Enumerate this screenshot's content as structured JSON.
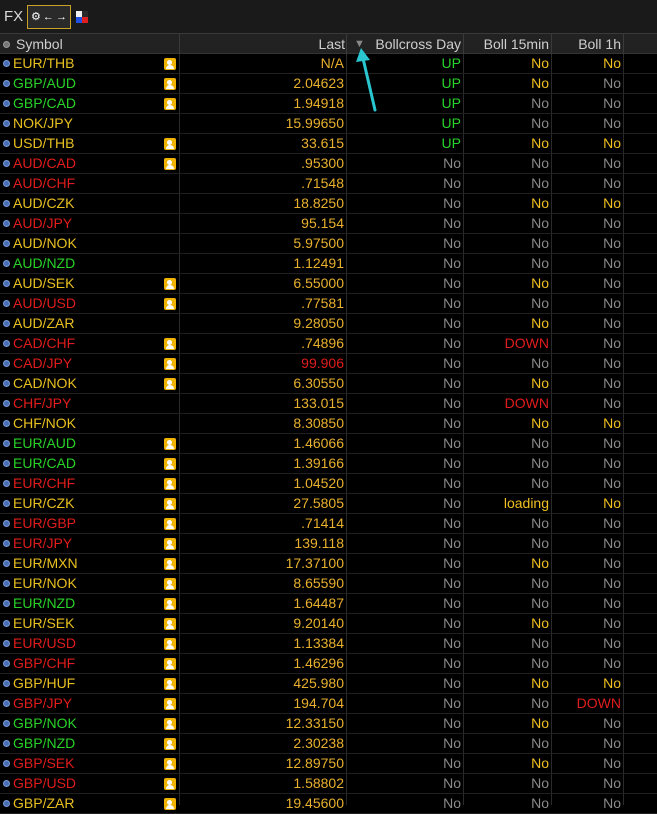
{
  "window": {
    "title": "FX"
  },
  "toolbar": {
    "settings_icon": "gear-icon",
    "link_icon": "link-color-icon"
  },
  "headers": {
    "symbol": "Symbol",
    "last": "Last",
    "bollcross_day": "Bollcross Day",
    "boll_15min": "Boll 15min",
    "boll_1h": "Boll 1h"
  },
  "sort": {
    "column": "bollcross_day",
    "direction": "descending"
  },
  "colors": {
    "up": "#29d229",
    "down": "#e01c1c",
    "neutral": "#e8c020",
    "no_dim": "#8a8a8a",
    "no_yellow": "#f0c020",
    "down_red": "#e01c1c",
    "loading": "#f0c020",
    "last": "#e8b02e",
    "arrow": "#29c6d0"
  },
  "rows": [
    {
      "symbol": "EUR/THB",
      "sym_color": "neutral",
      "alert": true,
      "last": "N/A",
      "bcd": "UP",
      "b15": "No",
      "b15c": "yellow",
      "b1h": "No",
      "b1hc": "yellow"
    },
    {
      "symbol": "GBP/AUD",
      "sym_color": "up",
      "alert": true,
      "last": "2.04623",
      "bcd": "UP",
      "b15": "No",
      "b15c": "yellow",
      "b1h": "No",
      "b1hc": "dim"
    },
    {
      "symbol": "GBP/CAD",
      "sym_color": "up",
      "alert": true,
      "last": "1.94918",
      "bcd": "UP",
      "b15": "No",
      "b15c": "dim",
      "b1h": "No",
      "b1hc": "dim"
    },
    {
      "symbol": "NOK/JPY",
      "sym_color": "neutral",
      "alert": false,
      "last": "15.99650",
      "bcd": "UP",
      "b15": "No",
      "b15c": "dim",
      "b1h": "No",
      "b1hc": "dim"
    },
    {
      "symbol": "USD/THB",
      "sym_color": "neutral",
      "alert": true,
      "last": "33.615",
      "bcd": "UP",
      "b15": "No",
      "b15c": "yellow",
      "b1h": "No",
      "b1hc": "yellow"
    },
    {
      "symbol": "AUD/CAD",
      "sym_color": "down",
      "alert": true,
      "last": ".95300",
      "bcd": "No",
      "b15": "No",
      "b15c": "dim",
      "b1h": "No",
      "b1hc": "dim"
    },
    {
      "symbol": "AUD/CHF",
      "sym_color": "down",
      "alert": false,
      "last": ".71548",
      "bcd": "No",
      "b15": "No",
      "b15c": "dim",
      "b1h": "No",
      "b1hc": "dim"
    },
    {
      "symbol": "AUD/CZK",
      "sym_color": "neutral",
      "alert": false,
      "last": "18.8250",
      "bcd": "No",
      "b15": "No",
      "b15c": "yellow",
      "b1h": "No",
      "b1hc": "yellow"
    },
    {
      "symbol": "AUD/JPY",
      "sym_color": "down",
      "alert": false,
      "last": "95.154",
      "bcd": "No",
      "b15": "No",
      "b15c": "dim",
      "b1h": "No",
      "b1hc": "dim"
    },
    {
      "symbol": "AUD/NOK",
      "sym_color": "neutral",
      "alert": false,
      "last": "5.97500",
      "bcd": "No",
      "b15": "No",
      "b15c": "dim",
      "b1h": "No",
      "b1hc": "dim"
    },
    {
      "symbol": "AUD/NZD",
      "sym_color": "up",
      "alert": false,
      "last": "1.12491",
      "bcd": "No",
      "b15": "No",
      "b15c": "dim",
      "b1h": "No",
      "b1hc": "dim"
    },
    {
      "symbol": "AUD/SEK",
      "sym_color": "neutral",
      "alert": true,
      "last": "6.55000",
      "bcd": "No",
      "b15": "No",
      "b15c": "yellow",
      "b1h": "No",
      "b1hc": "dim"
    },
    {
      "symbol": "AUD/USD",
      "sym_color": "down",
      "alert": true,
      "last": ".77581",
      "bcd": "No",
      "b15": "No",
      "b15c": "dim",
      "b1h": "No",
      "b1hc": "dim"
    },
    {
      "symbol": "AUD/ZAR",
      "sym_color": "neutral",
      "alert": false,
      "last": "9.28050",
      "bcd": "No",
      "b15": "No",
      "b15c": "yellow",
      "b1h": "No",
      "b1hc": "dim"
    },
    {
      "symbol": "CAD/CHF",
      "sym_color": "down",
      "alert": true,
      "last": ".74896",
      "bcd": "No",
      "b15": "DOWN",
      "b15c": "red",
      "b1h": "No",
      "b1hc": "dim"
    },
    {
      "symbol": "CAD/JPY",
      "sym_color": "down",
      "alert": true,
      "last": "99.906",
      "last_red": true,
      "bcd": "No",
      "b15": "No",
      "b15c": "dim",
      "b1h": "No",
      "b1hc": "dim"
    },
    {
      "symbol": "CAD/NOK",
      "sym_color": "neutral",
      "alert": true,
      "last": "6.30550",
      "bcd": "No",
      "b15": "No",
      "b15c": "yellow",
      "b1h": "No",
      "b1hc": "dim"
    },
    {
      "symbol": "CHF/JPY",
      "sym_color": "down",
      "alert": false,
      "last": "133.015",
      "bcd": "No",
      "b15": "DOWN",
      "b15c": "red",
      "b1h": "No",
      "b1hc": "dim"
    },
    {
      "symbol": "CHF/NOK",
      "sym_color": "neutral",
      "alert": false,
      "last": "8.30850",
      "bcd": "No",
      "b15": "No",
      "b15c": "yellow",
      "b1h": "No",
      "b1hc": "yellow"
    },
    {
      "symbol": "EUR/AUD",
      "sym_color": "up",
      "alert": true,
      "last": "1.46066",
      "bcd": "No",
      "b15": "No",
      "b15c": "dim",
      "b1h": "No",
      "b1hc": "dim"
    },
    {
      "symbol": "EUR/CAD",
      "sym_color": "up",
      "alert": true,
      "last": "1.39166",
      "bcd": "No",
      "b15": "No",
      "b15c": "dim",
      "b1h": "No",
      "b1hc": "dim"
    },
    {
      "symbol": "EUR/CHF",
      "sym_color": "down",
      "alert": true,
      "last": "1.04520",
      "bcd": "No",
      "b15": "No",
      "b15c": "dim",
      "b1h": "No",
      "b1hc": "dim"
    },
    {
      "symbol": "EUR/CZK",
      "sym_color": "neutral",
      "alert": true,
      "last": "27.5805",
      "bcd": "No",
      "b15": "loading",
      "b15c": "loading",
      "b1h": "No",
      "b1hc": "yellow"
    },
    {
      "symbol": "EUR/GBP",
      "sym_color": "down",
      "alert": true,
      "last": ".71414",
      "bcd": "No",
      "b15": "No",
      "b15c": "dim",
      "b1h": "No",
      "b1hc": "dim"
    },
    {
      "symbol": "EUR/JPY",
      "sym_color": "down",
      "alert": true,
      "last": "139.118",
      "bcd": "No",
      "b15": "No",
      "b15c": "dim",
      "b1h": "No",
      "b1hc": "dim"
    },
    {
      "symbol": "EUR/MXN",
      "sym_color": "neutral",
      "alert": true,
      "last": "17.37100",
      "bcd": "No",
      "b15": "No",
      "b15c": "yellow",
      "b1h": "No",
      "b1hc": "dim"
    },
    {
      "symbol": "EUR/NOK",
      "sym_color": "neutral",
      "alert": true,
      "last": "8.65590",
      "bcd": "No",
      "b15": "No",
      "b15c": "dim",
      "b1h": "No",
      "b1hc": "dim"
    },
    {
      "symbol": "EUR/NZD",
      "sym_color": "up",
      "alert": true,
      "last": "1.64487",
      "bcd": "No",
      "b15": "No",
      "b15c": "dim",
      "b1h": "No",
      "b1hc": "dim"
    },
    {
      "symbol": "EUR/SEK",
      "sym_color": "neutral",
      "alert": true,
      "last": "9.20140",
      "bcd": "No",
      "b15": "No",
      "b15c": "yellow",
      "b1h": "No",
      "b1hc": "dim"
    },
    {
      "symbol": "EUR/USD",
      "sym_color": "down",
      "alert": true,
      "last": "1.13384",
      "bcd": "No",
      "b15": "No",
      "b15c": "dim",
      "b1h": "No",
      "b1hc": "dim"
    },
    {
      "symbol": "GBP/CHF",
      "sym_color": "down",
      "alert": true,
      "last": "1.46296",
      "bcd": "No",
      "b15": "No",
      "b15c": "dim",
      "b1h": "No",
      "b1hc": "dim"
    },
    {
      "symbol": "GBP/HUF",
      "sym_color": "neutral",
      "alert": true,
      "last": "425.980",
      "bcd": "No",
      "b15": "No",
      "b15c": "yellow",
      "b1h": "No",
      "b1hc": "yellow"
    },
    {
      "symbol": "GBP/JPY",
      "sym_color": "down",
      "alert": true,
      "last": "194.704",
      "bcd": "No",
      "b15": "No",
      "b15c": "dim",
      "b1h": "DOWN",
      "b1hc": "red"
    },
    {
      "symbol": "GBP/NOK",
      "sym_color": "up",
      "alert": true,
      "last": "12.33150",
      "bcd": "No",
      "b15": "No",
      "b15c": "yellow",
      "b1h": "No",
      "b1hc": "dim"
    },
    {
      "symbol": "GBP/NZD",
      "sym_color": "up",
      "alert": true,
      "last": "2.30238",
      "bcd": "No",
      "b15": "No",
      "b15c": "dim",
      "b1h": "No",
      "b1hc": "dim"
    },
    {
      "symbol": "GBP/SEK",
      "sym_color": "down",
      "alert": true,
      "last": "12.89750",
      "bcd": "No",
      "b15": "No",
      "b15c": "yellow",
      "b1h": "No",
      "b1hc": "dim"
    },
    {
      "symbol": "GBP/USD",
      "sym_color": "down",
      "alert": true,
      "last": "1.58802",
      "bcd": "No",
      "b15": "No",
      "b15c": "dim",
      "b1h": "No",
      "b1hc": "dim"
    },
    {
      "symbol": "GBP/ZAR",
      "sym_color": "neutral",
      "alert": true,
      "last": "19.45600",
      "bcd": "No",
      "b15": "No",
      "b15c": "dim",
      "b1h": "No",
      "b1hc": "dim"
    }
  ]
}
